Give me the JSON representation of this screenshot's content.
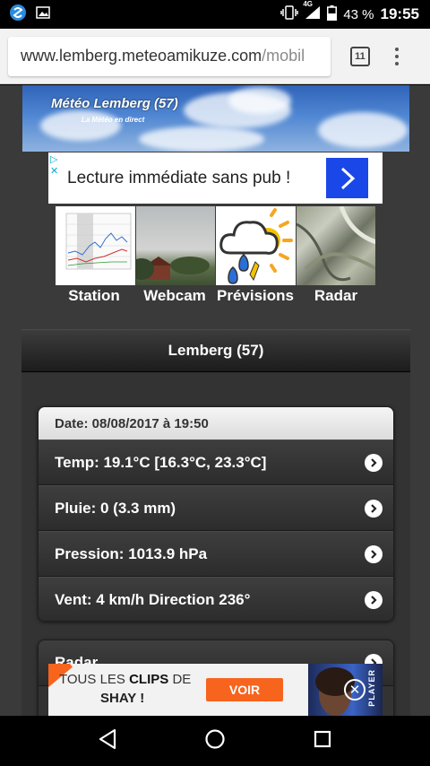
{
  "status_bar": {
    "network": "4G",
    "battery": "43 %",
    "time": "19:55"
  },
  "browser": {
    "url_main": "www.lemberg.meteoamikuze.com",
    "url_rest": "/mobil",
    "tab_count": "11"
  },
  "banner": {
    "title": "Météo Lemberg (57)",
    "subtitle": "La Météo en direct"
  },
  "ad_top": {
    "text": "Lecture immédiate sans pub !"
  },
  "nav": {
    "items": [
      {
        "label": "Station"
      },
      {
        "label": "Webcam"
      },
      {
        "label": "Prévisions"
      },
      {
        "label": "Radar"
      }
    ]
  },
  "page": {
    "header": "Lemberg (57)"
  },
  "weather": {
    "date": "Date: 08/08/2017 à 19:50",
    "rows": [
      {
        "label": "Temp: 19.1°C [16.3°C, 23.3°C]"
      },
      {
        "label": "Pluie: 0 (3.3 mm)"
      },
      {
        "label": "Pression: 1013.9 hPa"
      },
      {
        "label": "Vent: 4 km/h Direction 236°"
      }
    ]
  },
  "second_card": {
    "row": "Radar"
  },
  "ad_bottom": {
    "line1_prefix": "TOUS LES",
    "line1_bold": "CLIPS",
    "line1_suffix": "DE",
    "line2": "SHAY !",
    "button": "VOIR",
    "brand": "PLAYER"
  }
}
